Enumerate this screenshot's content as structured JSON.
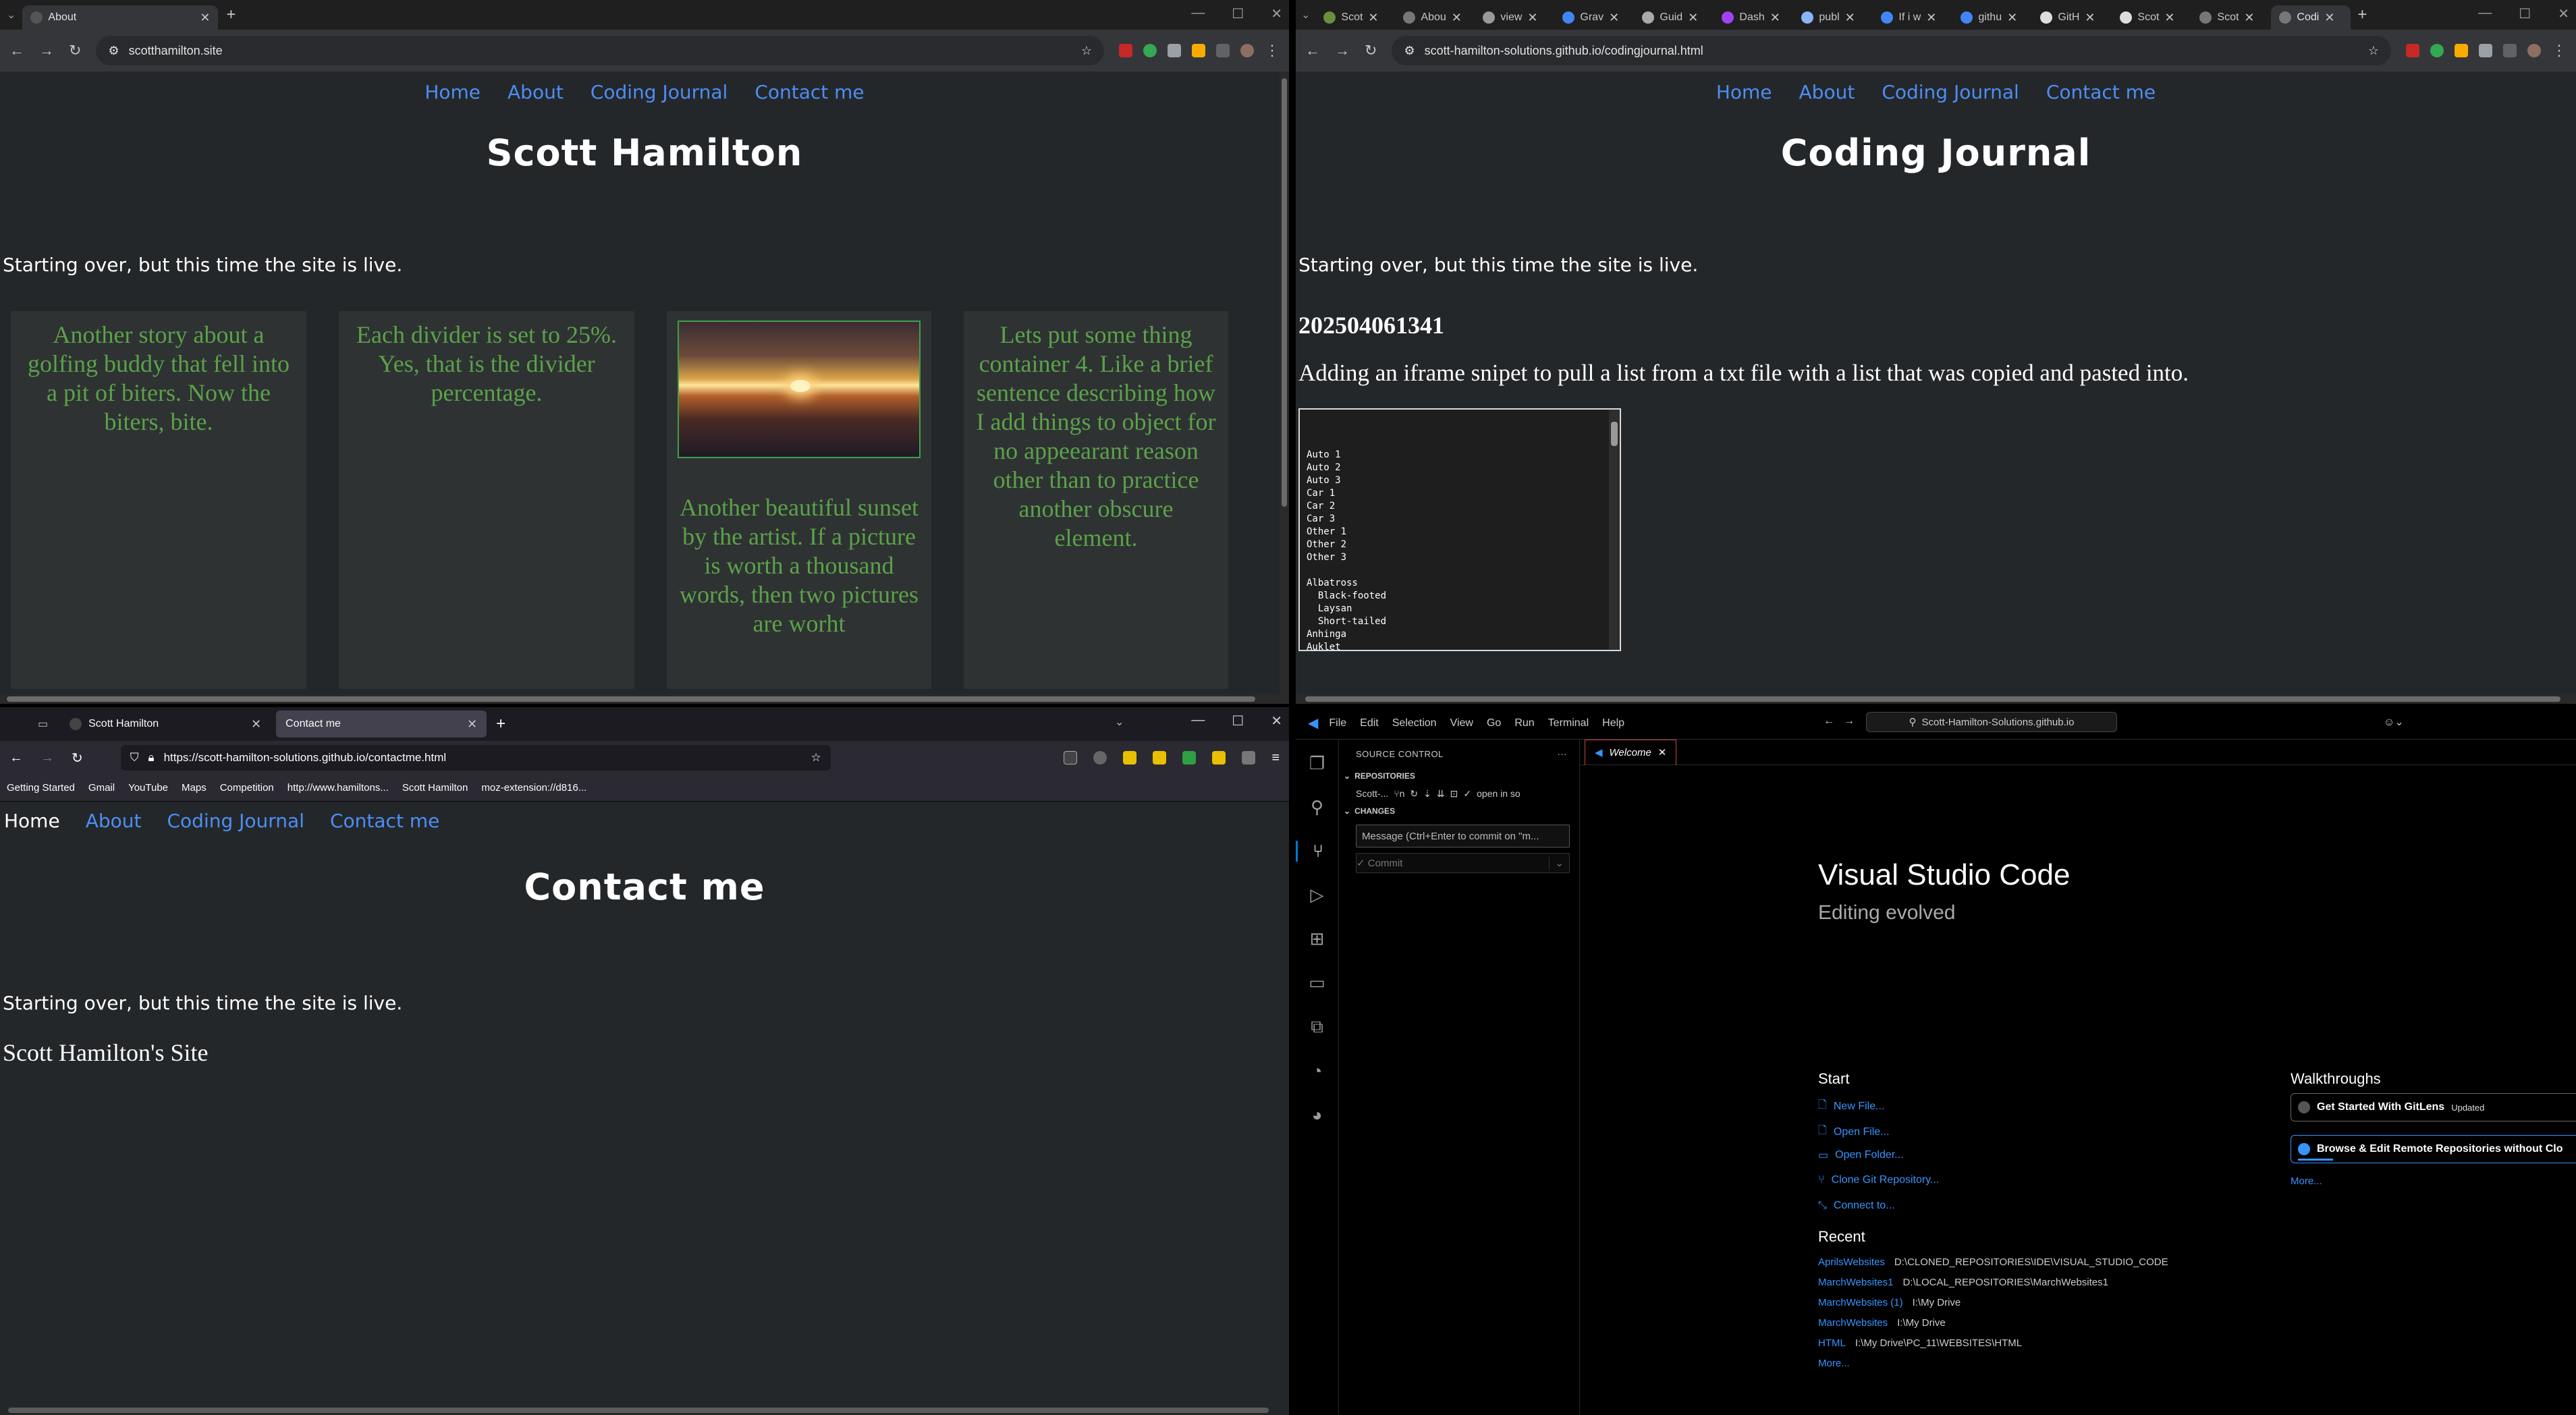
{
  "q1": {
    "tab": {
      "title": "About"
    },
    "url": "scotthamilton.site",
    "nav": [
      "Home",
      "About",
      "Coding Journal",
      "Contact me"
    ],
    "heading": "Scott Hamilton",
    "tagline": "Starting over, but this time the site is live.",
    "col1": "Another story about a golfing buddy that fell into a pit of biters. Now the biters, bite.",
    "col2": "Each divider is set to 25%. Yes, that is the divider percentage.",
    "col3": "Another beautiful sunset by the artist. If a picture is worth a thousand words, then two pictures are worht",
    "col4": "Lets put some thing container 4. Like a brief sentence describing how I add things to object for no appeearant reason other than to practice another obscure element."
  },
  "q2": {
    "tabs": [
      "Scot",
      "Abou",
      "view",
      "Grav",
      "Guid",
      "Dash",
      "publ",
      "If i w",
      "githu",
      "GitH",
      "Scot",
      "Scot",
      "Codi"
    ],
    "url": "scott-hamilton-solutions.github.io/codingjournal.html",
    "nav": [
      "Home",
      "About",
      "Coding Journal",
      "Contact me"
    ],
    "heading": "Coding Journal",
    "tagline": "Starting over, but this time the site is live.",
    "entry_id": "202504061341",
    "entry_text": "Adding an iframe snipet to pull a list from a txt file with a list that was copied and pasted into.",
    "iframe_text": "Auto 1\nAuto 2\nAuto 3\nCar 1\nCar 2\nCar 3\nOther 1\nOther 2\nOther 3\n\nAlbatross\n  Black-footed\n  Laysan\n  Short-tailed\nAnhinga\nAuklet\n  Cassin's"
  },
  "q3": {
    "tabs": [
      "Scott Hamilton",
      "Contact me"
    ],
    "url": "https://scott-hamilton-solutions.github.io/contactme.html",
    "bookmarks": [
      "Getting Started",
      "Gmail",
      "YouTube",
      "Maps",
      "Competition",
      "http://www.hamiltons...",
      "Scott Hamilton",
      "moz-extension://d816..."
    ],
    "nav": [
      "Home",
      "About",
      "Coding Journal",
      "Contact me"
    ],
    "heading": "Contact me",
    "tagline": "Starting over, but this time the site is live.",
    "site_name": "Scott Hamilton's Site"
  },
  "q4": {
    "menu": [
      "File",
      "Edit",
      "Selection",
      "View",
      "Go",
      "Run",
      "Terminal",
      "Help"
    ],
    "search": "Scott-Hamilton-Solutions.github.io",
    "sidebar_title": "SOURCE CONTROL",
    "repositories_label": "REPOSITORIES",
    "repo_name": "Scott-...",
    "repo_action": "open in so",
    "changes_label": "CHANGES",
    "commit_placeholder": "Message (Ctrl+Enter to commit on \"m...",
    "commit_label": "✓ Commit",
    "tab": "Welcome",
    "title": "Visual Studio Code",
    "subtitle": "Editing evolved",
    "start_label": "Start",
    "start_links": [
      "New File...",
      "Open File...",
      "Open Folder...",
      "Clone Git Repository...",
      "Connect to..."
    ],
    "recent_label": "Recent",
    "recent": [
      {
        "name": "AprilsWebsites",
        "path": "D:\\CLONED_REPOSITORIES\\IDE\\VISUAL_STUDIO_CODE"
      },
      {
        "name": "MarchWebsites1",
        "path": "D:\\LOCAL_REPOSITORIES\\MarchWebsites1"
      },
      {
        "name": "MarchWebsites (1)",
        "path": "I:\\My Drive"
      },
      {
        "name": "MarchWebsites",
        "path": "I:\\My Drive"
      },
      {
        "name": "HTML",
        "path": "I:\\My Drive\\PC_11\\WEBSITES\\HTML"
      }
    ],
    "more": "More...",
    "walkthroughs_label": "Walkthroughs",
    "walk1": "Get Started With GitLens",
    "walk1_badge": "Updated",
    "walk2": "Browse & Edit Remote Repositories without Clo",
    "walk_more": "More..."
  }
}
